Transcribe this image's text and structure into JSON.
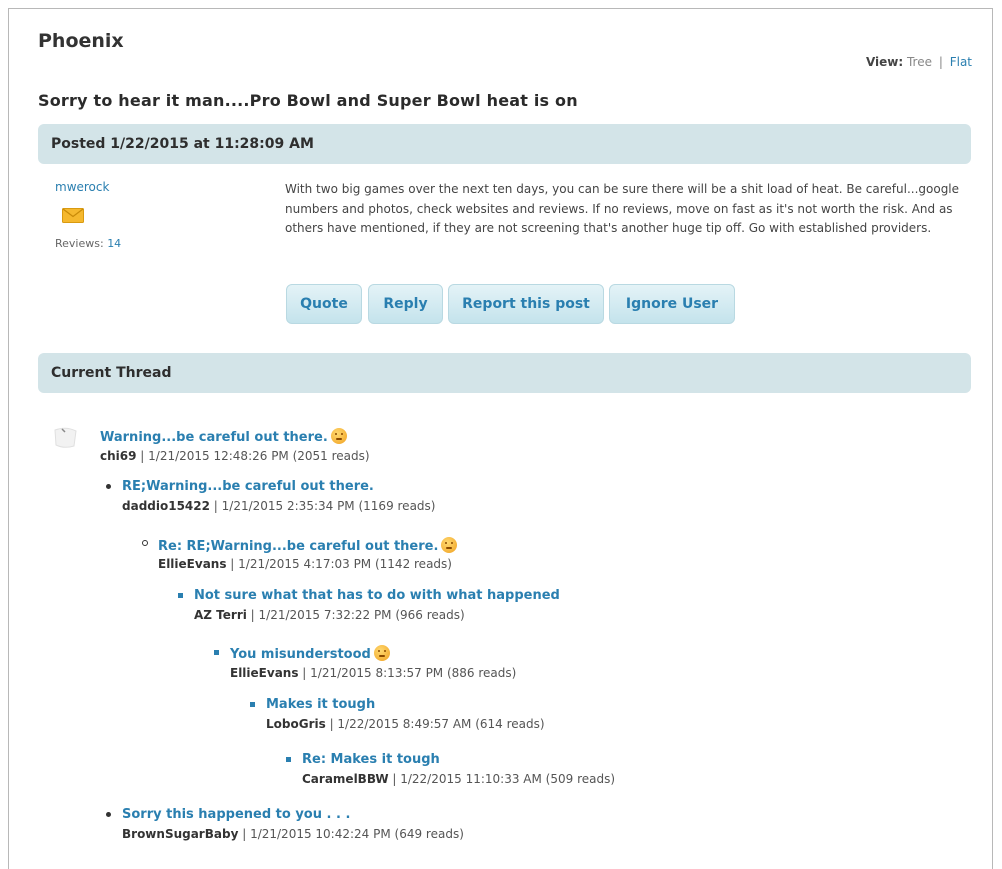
{
  "forum_title": "Phoenix",
  "view": {
    "label": "View:",
    "tree": "Tree",
    "separator": "|",
    "flat": "Flat"
  },
  "post": {
    "subject": "Sorry to hear it man....Pro Bowl and Super Bowl heat is on",
    "posted_header": "Posted 1/22/2015 at 11:28:09 AM",
    "author": "mwerock",
    "reviews_label": "Reviews:",
    "reviews_count": "14",
    "body": "With two big games over the next ten days, you can be sure there will be a shit load of heat.  Be careful...google numbers and photos, check websites and reviews.  If no reviews, move on fast as it's not worth the risk.  And as others have mentioned, if they are not screening that's another huge tip off.  Go with established providers."
  },
  "buttons": {
    "quote": "Quote",
    "reply": "Reply",
    "report": "Report this post",
    "ignore": "Ignore User"
  },
  "thread": {
    "header": "Current Thread",
    "items": [
      {
        "title": "Warning...be careful out there.",
        "user": "chi69",
        "meta": " | 1/21/2015 12:48:26 PM (2051 reads)"
      },
      {
        "title": "RE;Warning...be careful out there.",
        "user": "daddio15422",
        "meta": " | 1/21/2015 2:35:34 PM (1169 reads)"
      },
      {
        "title": "Re: RE;Warning...be careful out there.",
        "user": "EllieEvans",
        "meta": " | 1/21/2015 4:17:03 PM (1142 reads)"
      },
      {
        "title": "Not sure what that has to do with what happened",
        "user": "AZ Terri",
        "meta": " | 1/21/2015 7:32:22 PM (966 reads)"
      },
      {
        "title": "You misunderstood",
        "user": "EllieEvans",
        "meta": " | 1/21/2015 8:13:57 PM (886 reads)"
      },
      {
        "title": "Makes it tough",
        "user": "LoboGris",
        "meta": " | 1/22/2015 8:49:57 AM (614 reads)"
      },
      {
        "title": "Re: Makes it tough",
        "user": "CaramelBBW",
        "meta": " | 1/22/2015 11:10:33 AM (509 reads)"
      },
      {
        "title": "Sorry this happened to you . . .",
        "user": "BrownSugarBaby",
        "meta": " | 1/21/2015 10:42:24 PM (649 reads)"
      }
    ]
  },
  "colors": {
    "accent": "#2a7fb0",
    "bar": "#d3e4e8",
    "button": "#c4e3ec"
  }
}
